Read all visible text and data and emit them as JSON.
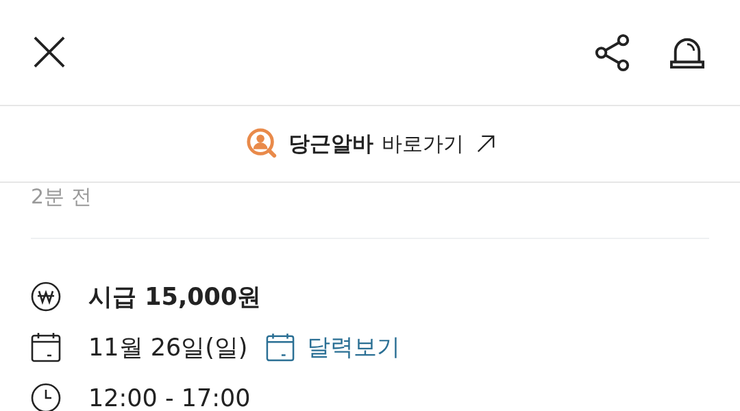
{
  "banner": {
    "brand": "당근알바",
    "link": "바로가기"
  },
  "posted": "2분 전",
  "details": [
    {
      "kind": "wage",
      "text": "시급 15,000원"
    },
    {
      "kind": "date",
      "text": "11월 26일(일)",
      "action": "달력보기"
    },
    {
      "kind": "time",
      "text": "12:00 - 17:00"
    }
  ]
}
